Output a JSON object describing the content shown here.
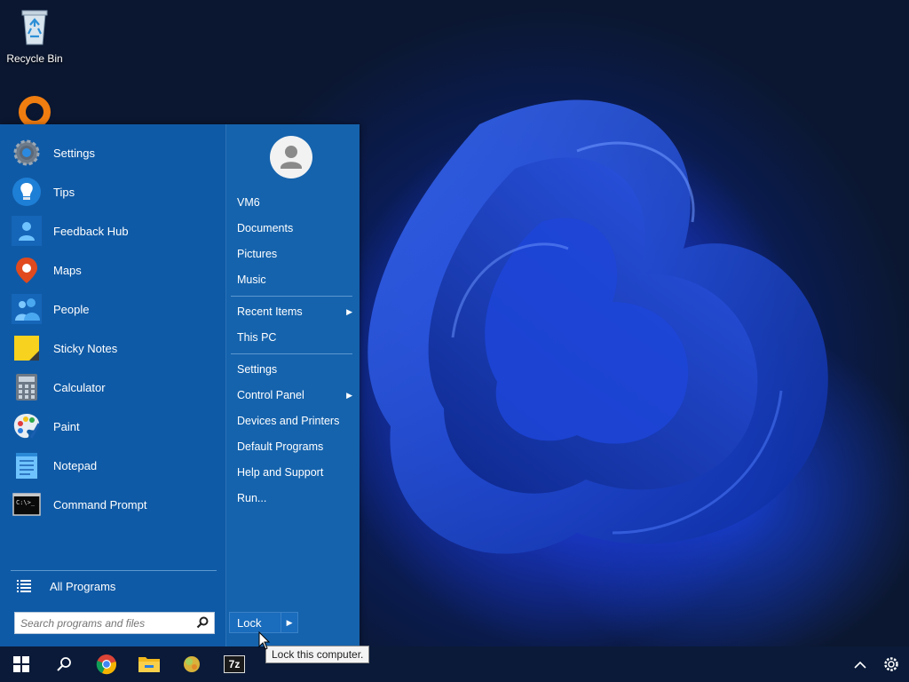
{
  "desktop": {
    "icons": [
      {
        "label": "Recycle Bin",
        "icon": "recycle-bin-icon"
      },
      {
        "label": "",
        "icon": "orange-app-icon"
      }
    ]
  },
  "start_menu": {
    "apps": [
      {
        "label": "Settings",
        "icon": "settings-gear-icon"
      },
      {
        "label": "Tips",
        "icon": "lightbulb-icon"
      },
      {
        "label": "Feedback Hub",
        "icon": "feedback-person-icon"
      },
      {
        "label": "Maps",
        "icon": "map-pin-icon"
      },
      {
        "label": "People",
        "icon": "people-icon"
      },
      {
        "label": "Sticky Notes",
        "icon": "sticky-note-icon"
      },
      {
        "label": "Calculator",
        "icon": "calculator-icon"
      },
      {
        "label": "Paint",
        "icon": "paint-palette-icon"
      },
      {
        "label": "Notepad",
        "icon": "notepad-icon"
      },
      {
        "label": "Command Prompt",
        "icon": "command-prompt-icon"
      }
    ],
    "all_programs": "All Programs",
    "search_placeholder": "Search programs and files",
    "right_items": {
      "user": "VM6",
      "documents": "Documents",
      "pictures": "Pictures",
      "music": "Music",
      "recent_items": "Recent Items",
      "this_pc": "This PC",
      "settings": "Settings",
      "control_panel": "Control Panel",
      "devices_printers": "Devices and Printers",
      "default_programs": "Default Programs",
      "help_support": "Help and Support",
      "run": "Run..."
    },
    "lock_label": "Lock",
    "tooltip": "Lock this computer."
  },
  "taskbar": {
    "items": [
      "windows-start-icon",
      "search-icon",
      "chrome-icon",
      "file-explorer-icon",
      "app-ball-icon",
      "7zip-icon"
    ],
    "seven_zip_label": "7z",
    "tray": [
      "chevron-up-icon",
      "gear-icon"
    ]
  },
  "colors": {
    "menu_left": "#0f5aa6",
    "menu_right": "#1563ad",
    "taskbar": "#0a1a38"
  }
}
